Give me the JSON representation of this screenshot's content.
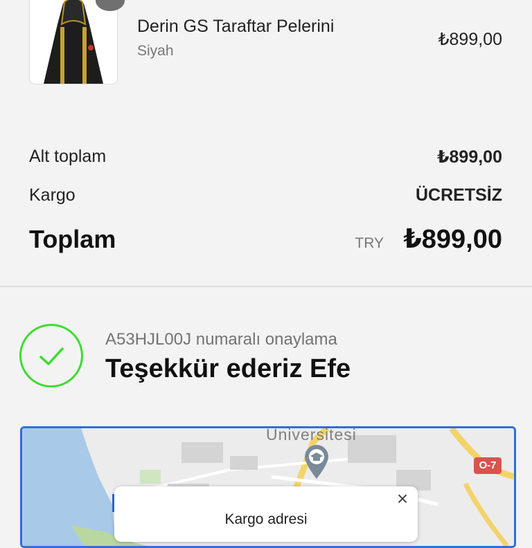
{
  "product": {
    "name": "Derin GS Taraftar Pelerini",
    "variant": "Siyah",
    "price": "₺899,00"
  },
  "summary": {
    "subtotal_label": "Alt toplam",
    "subtotal_value": "₺899,00",
    "shipping_label": "Kargo",
    "shipping_value": "ÜCRETSİZ",
    "total_label": "Toplam",
    "currency_code": "TRY",
    "total_value": "₺899,00"
  },
  "confirmation": {
    "number_line": "A53HJL00J numaralı onaylama",
    "thanks": "Teşekkür ederiz Efe"
  },
  "map": {
    "label": "Universitesi",
    "road_badge": "O-7"
  },
  "popup": {
    "title": "Kargo adresi",
    "close_symbol": "×"
  },
  "colors": {
    "accent_green": "#3ddc2f",
    "map_border": "#2f6fd6"
  }
}
